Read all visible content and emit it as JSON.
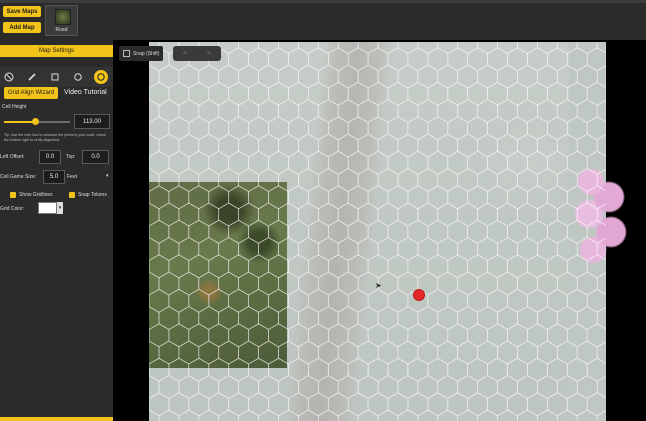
{
  "toolbar": {
    "save_maps": "Save Maps",
    "add_map": "Add Map",
    "map_thumb_label": "Road"
  },
  "sidebar": {
    "header": "Map Settings",
    "tools": [
      "ban-icon",
      "pen-icon",
      "square-icon",
      "circle-icon",
      "hex-icon"
    ],
    "active_tool": "hex-icon",
    "grid_align_wizard": "Grid Align Wizard",
    "video_tutorial": "Video Tutorial",
    "cell_height_label": "Cell Height",
    "cell_height_value": "113.00",
    "cell_height_slider": 0.47,
    "tip": "Tip: Use the ruler tool to measure the pixels in your scale, check the bottom right to verify alignment.",
    "left_offset_label": "Left Offset:",
    "left_offset_value": "0.0",
    "top_label": "Top:",
    "top_value": "0.0",
    "cell_game_size_label": "Cell Game Size:",
    "cell_game_size_value": "5.0",
    "unit_value": "Feet",
    "show_gridlines_label": "Show Gridlines",
    "show_gridlines": true,
    "snap_tokens_label": "Snap Tokens",
    "snap_tokens": true,
    "grid_color_label": "Grid Color:",
    "grid_color_value": "#ffffff"
  },
  "canvas": {
    "snap_label": "Snap (Shift)",
    "undo_label": "↶",
    "redo_label": "↷",
    "token_color": "#e4272b"
  }
}
